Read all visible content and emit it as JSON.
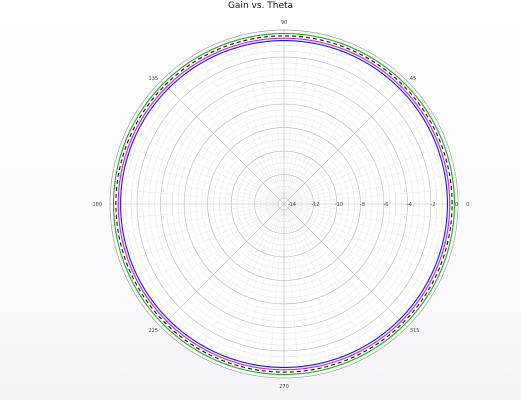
{
  "chart_data": {
    "type": "line",
    "title": "Gain vs. Theta",
    "angular_tick_labels": [
      "0",
      "45",
      "90",
      "135",
      "180",
      "225",
      "270",
      "315"
    ],
    "radial_tick_labels": [
      "-14",
      "-12",
      "-10",
      "-8",
      "-6",
      "-4",
      "-2",
      "0"
    ],
    "rlim": [
      -14.5,
      0.3
    ],
    "grid": true,
    "series": [
      {
        "style": "solid",
        "color": "#1a1ad9",
        "values_db": [
          -0.6,
          -0.6,
          -0.6,
          -0.6,
          -0.6,
          -0.6,
          -0.6,
          -0.6
        ]
      },
      {
        "style": "solid",
        "color": "#cc22cc",
        "values_db": [
          -0.4,
          -0.4,
          -0.4,
          -0.4,
          -0.4,
          -0.4,
          -0.4,
          -0.4
        ]
      },
      {
        "style": "dashed",
        "color": "#111111",
        "values_db": [
          -0.2,
          -0.2,
          -0.2,
          -0.2,
          -0.2,
          -0.2,
          -0.2,
          -0.2
        ]
      },
      {
        "style": "solid",
        "color": "#22aa22",
        "values_db": [
          0.0,
          0.0,
          0.0,
          0.0,
          0.0,
          0.0,
          0.0,
          0.0
        ]
      }
    ]
  }
}
